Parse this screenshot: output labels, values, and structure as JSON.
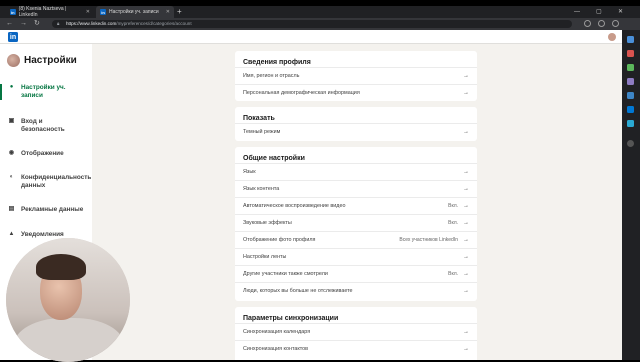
{
  "browser": {
    "tabs": [
      {
        "favicon": "in",
        "label": "(8) Ksenia Naztseva | LinkedIn"
      },
      {
        "favicon": "in",
        "label": "Настройки уч. записи"
      }
    ],
    "new_tab": "+",
    "url_host": "https://www.linkedin.com",
    "url_path": "/mypreferences/d/categories/account"
  },
  "sidebar": {
    "title": "Настройки",
    "items": [
      {
        "icon": "person-icon",
        "label": "Настройки уч. записи"
      },
      {
        "icon": "lock-icon",
        "label": "Вход и безопасность"
      },
      {
        "icon": "eye-icon",
        "label": "Отображение"
      },
      {
        "icon": "shield-icon",
        "label": "Конфиденциальность данных"
      },
      {
        "icon": "ad-icon",
        "label": "Рекламные данные"
      },
      {
        "icon": "bell-icon",
        "label": "Уведомления"
      }
    ]
  },
  "sections": [
    {
      "title": "Сведения профиля",
      "rows": [
        {
          "label": "Имя, регион и отрасль",
          "value": ""
        },
        {
          "label": "Персональная демографическая информация",
          "value": ""
        }
      ]
    },
    {
      "title": "Показать",
      "rows": [
        {
          "label": "Темный режим",
          "value": ""
        }
      ]
    },
    {
      "title": "Общие настройки",
      "rows": [
        {
          "label": "Язык",
          "value": ""
        },
        {
          "label": "Язык контента",
          "value": ""
        },
        {
          "label": "Автоматическое воспроизведение видео",
          "value": "Вкл."
        },
        {
          "label": "Звуковые эффекты",
          "value": "Вкл."
        },
        {
          "label": "Отображение фото профиля",
          "value": "Всех участников LinkedIn"
        },
        {
          "label": "Настройки ленты",
          "value": ""
        },
        {
          "label": "Другие участники также смотрели",
          "value": "Вкл."
        },
        {
          "label": "Люди, которых вы больше не отслеживаете",
          "value": ""
        }
      ]
    },
    {
      "title": "Параметры синхронизации",
      "rows": [
        {
          "label": "Синхронизация календаря",
          "value": ""
        },
        {
          "label": "Синхронизация контактов",
          "value": ""
        }
      ]
    }
  ],
  "colors": {
    "accent": "#057642",
    "brand": "#0a66c2",
    "page_bg": "#f4f2ee"
  }
}
